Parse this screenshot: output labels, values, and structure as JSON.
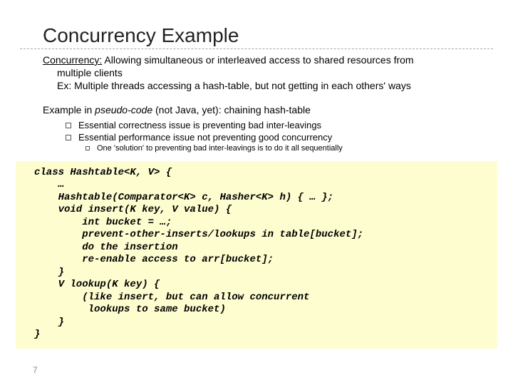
{
  "title": "Concurrency Example",
  "definition": {
    "term": "Concurrency:",
    "body": " Allowing simultaneous or interleaved access to shared resources from",
    "cont1": "multiple clients",
    "cont2": "Ex: Multiple threads accessing a hash-table, but not getting in each others' ways"
  },
  "example_intro_pre": "Example in ",
  "example_intro_ital": "pseudo-code",
  "example_intro_post": " (not Java, yet): chaining hash-table",
  "bul1": "Essential correctness issue is preventing bad inter-leavings",
  "bul2": "Essential performance issue not preventing good concurrency",
  "bul2a": "One 'solution' to preventing bad inter-leavings is to do it all sequentially",
  "code": "class Hashtable<K, V> {\n    …\n    Hashtable(Comparator<K> c, Hasher<K> h) { … };\n    void insert(K key, V value) {\n        int bucket = …;\n        prevent-other-inserts/lookups in table[bucket];\n        do the insertion\n        re-enable access to arr[bucket];\n    }\n    V lookup(K key) {\n        (like insert, but can allow concurrent\n         lookups to same bucket)\n    }\n}",
  "pagenum": "7"
}
